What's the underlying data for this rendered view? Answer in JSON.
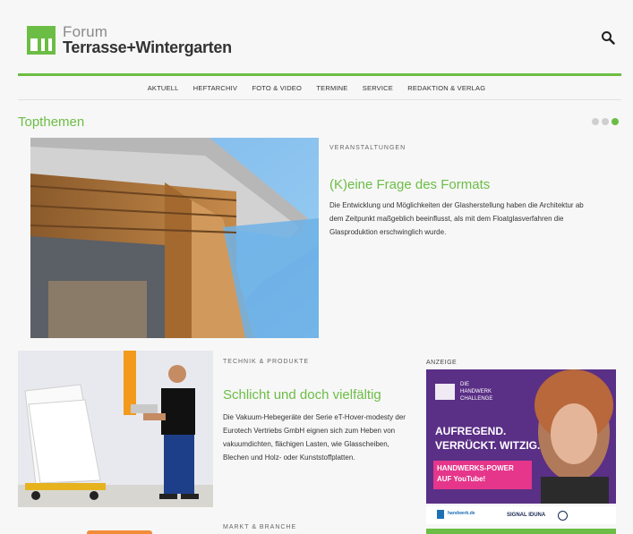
{
  "header": {
    "logo_top": "Forum",
    "logo_bottom": "Terrasse+Wintergarten"
  },
  "nav": {
    "items": [
      "Aktuell",
      "Heftarchiv",
      "Foto & Video",
      "Termine",
      "Service",
      "Redaktion & Verlag"
    ]
  },
  "section": {
    "title": "Topthemen"
  },
  "features": [
    {
      "category": "Veranstaltungen",
      "headline": "(K)eine Frage des Formats",
      "teaser": "Die Entwicklung und Möglichkeiten der Glasherstellung haben die Architektur ab dem Zeitpunkt maßgeblich beeinflusst, als mit dem Floatglasverfahren die Glasproduktion erschwinglich wurde."
    },
    {
      "category": "Technik & Produkte",
      "headline": "Schlicht und doch vielfältig",
      "teaser": "Die Vakuum-Hebegeräte der Serie eT-Hover-modesty der Eurotech Vertriebs GmbH eignen sich zum Heben von vakuumdichten, flächigen Lasten, wie Glasscheiben, Blechen und Holz- oder Kunststoffplatten."
    },
    {
      "category": "Markt & Branche"
    }
  ],
  "ad": {
    "label": "Anzeige",
    "badge_top": "DIE",
    "badge_mid": "HANDWERK",
    "badge_bottom": "CHALLENGE",
    "line1": "AUFREGEND.",
    "line2": "VERRÜCKT. WITZIG.",
    "cta1": "HANDWERKS-POWER",
    "cta2": "AUF YouTube!",
    "sponsor1": "handwerk.de",
    "sponsor2": "SIGNAL IDUNA"
  },
  "colors": {
    "accent": "#6cbd45",
    "ad_bg": "#5a2f86",
    "ad_cta": "#e5368b"
  },
  "carousel": {
    "slides": 3,
    "active": 3
  }
}
